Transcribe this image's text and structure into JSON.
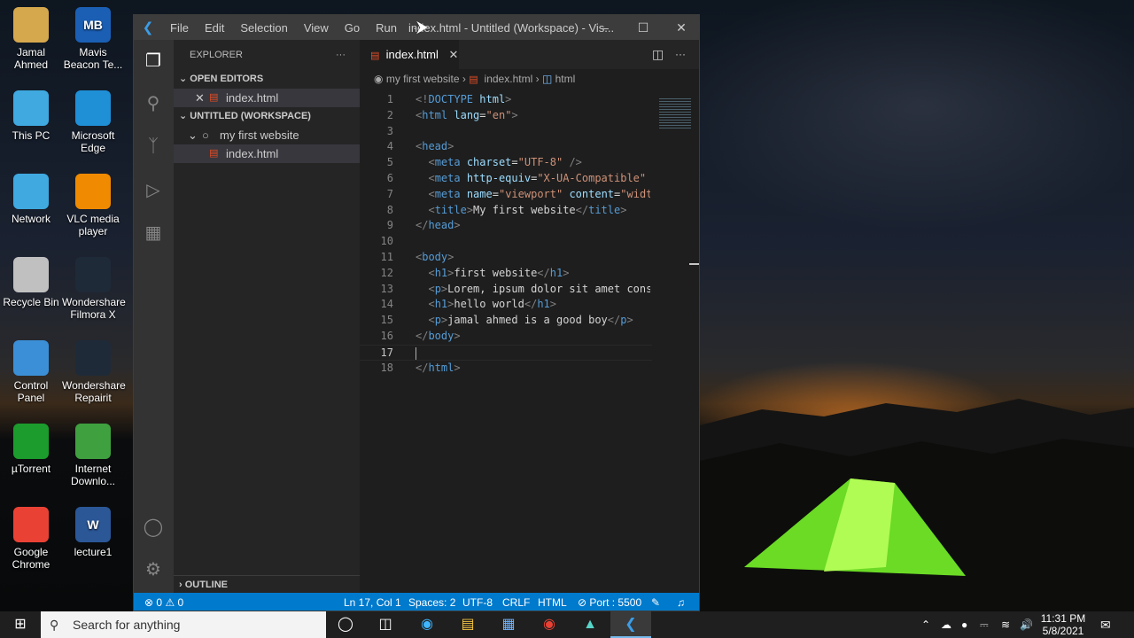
{
  "desktop": {
    "icons": [
      {
        "label": "Jamal Ahmed",
        "icon": "user-folder-icon"
      },
      {
        "label": "Mavis Beacon Te...",
        "icon": "mavis-beacon-icon",
        "glyph": "MB"
      },
      {
        "label": "This PC",
        "icon": "computer-icon"
      },
      {
        "label": "Microsoft Edge",
        "icon": "edge-icon"
      },
      {
        "label": "Network",
        "icon": "network-icon"
      },
      {
        "label": "VLC media player",
        "icon": "vlc-icon"
      },
      {
        "label": "Recycle Bin",
        "icon": "recycle-bin-icon"
      },
      {
        "label": "Wondershare Filmora X",
        "icon": "filmora-icon"
      },
      {
        "label": "Control Panel",
        "icon": "control-panel-icon"
      },
      {
        "label": "Wondershare Repairit",
        "icon": "repairit-icon"
      },
      {
        "label": "µTorrent",
        "icon": "utorrent-icon"
      },
      {
        "label": "Internet Downlo...",
        "icon": "idm-icon"
      },
      {
        "label": "Google Chrome",
        "icon": "chrome-icon"
      },
      {
        "label": "lecture1",
        "icon": "word-document-icon",
        "glyph": "W"
      }
    ]
  },
  "window": {
    "title": "index.html - Untitled (Workspace) - Vis...",
    "menu": [
      "File",
      "Edit",
      "Selection",
      "View",
      "Go",
      "Run",
      "···"
    ],
    "controls": {
      "minimize": "–",
      "maximize": "☐",
      "close": "✕"
    }
  },
  "sidebar": {
    "title": "EXPLORER",
    "more": "···",
    "open_editors_label": "OPEN EDITORS",
    "open_editors": [
      {
        "name": "index.html"
      }
    ],
    "workspace_label": "UNTITLED (WORKSPACE)",
    "folder": "my first website",
    "files": [
      {
        "name": "index.html"
      }
    ],
    "outline_label": "OUTLINE"
  },
  "editor": {
    "tab": "index.html",
    "breadcrumb": [
      "my first website",
      "index.html",
      "html"
    ],
    "current_line": 17,
    "lines": [
      [
        [
          "p",
          "<!"
        ],
        [
          "t",
          "DOCTYPE"
        ],
        [
          "x",
          " "
        ],
        [
          "a",
          "html"
        ],
        [
          "p",
          ">"
        ]
      ],
      [
        [
          "p",
          "<"
        ],
        [
          "t",
          "html"
        ],
        [
          "x",
          " "
        ],
        [
          "a",
          "lang"
        ],
        [
          "x",
          "="
        ],
        [
          "s",
          "\"en\""
        ],
        [
          "p",
          ">"
        ]
      ],
      [],
      [
        [
          "p",
          "<"
        ],
        [
          "t",
          "head"
        ],
        [
          "p",
          ">"
        ]
      ],
      [
        [
          "x",
          "  "
        ],
        [
          "p",
          "<"
        ],
        [
          "t",
          "meta"
        ],
        [
          "x",
          " "
        ],
        [
          "a",
          "charset"
        ],
        [
          "x",
          "="
        ],
        [
          "s",
          "\"UTF-8\""
        ],
        [
          "x",
          " "
        ],
        [
          "p",
          "/>"
        ]
      ],
      [
        [
          "x",
          "  "
        ],
        [
          "p",
          "<"
        ],
        [
          "t",
          "meta"
        ],
        [
          "x",
          " "
        ],
        [
          "a",
          "http-equiv"
        ],
        [
          "x",
          "="
        ],
        [
          "s",
          "\"X-UA-Compatible\""
        ]
      ],
      [
        [
          "x",
          "  "
        ],
        [
          "p",
          "<"
        ],
        [
          "t",
          "meta"
        ],
        [
          "x",
          " "
        ],
        [
          "a",
          "name"
        ],
        [
          "x",
          "="
        ],
        [
          "s",
          "\"viewport\""
        ],
        [
          "x",
          " "
        ],
        [
          "a",
          "content"
        ],
        [
          "x",
          "="
        ],
        [
          "s",
          "\"widt"
        ]
      ],
      [
        [
          "x",
          "  "
        ],
        [
          "p",
          "<"
        ],
        [
          "t",
          "title"
        ],
        [
          "p",
          ">"
        ],
        [
          "x",
          "My first website"
        ],
        [
          "p",
          "</"
        ],
        [
          "t",
          "title"
        ],
        [
          "p",
          ">"
        ]
      ],
      [
        [
          "p",
          "</"
        ],
        [
          "t",
          "head"
        ],
        [
          "p",
          ">"
        ]
      ],
      [],
      [
        [
          "p",
          "<"
        ],
        [
          "t",
          "body"
        ],
        [
          "p",
          ">"
        ]
      ],
      [
        [
          "x",
          "  "
        ],
        [
          "p",
          "<"
        ],
        [
          "t",
          "h1"
        ],
        [
          "p",
          ">"
        ],
        [
          "x",
          "first website"
        ],
        [
          "p",
          "</"
        ],
        [
          "t",
          "h1"
        ],
        [
          "p",
          ">"
        ]
      ],
      [
        [
          "x",
          "  "
        ],
        [
          "p",
          "<"
        ],
        [
          "t",
          "p"
        ],
        [
          "p",
          ">"
        ],
        [
          "x",
          "Lorem, ipsum dolor sit amet cons"
        ]
      ],
      [
        [
          "x",
          "  "
        ],
        [
          "p",
          "<"
        ],
        [
          "t",
          "h1"
        ],
        [
          "p",
          ">"
        ],
        [
          "x",
          "hello world"
        ],
        [
          "p",
          "</"
        ],
        [
          "t",
          "h1"
        ],
        [
          "p",
          ">"
        ]
      ],
      [
        [
          "x",
          "  "
        ],
        [
          "p",
          "<"
        ],
        [
          "t",
          "p"
        ],
        [
          "p",
          ">"
        ],
        [
          "x",
          "jamal ahmed is a good boy"
        ],
        [
          "p",
          "</"
        ],
        [
          "t",
          "p"
        ],
        [
          "p",
          ">"
        ]
      ],
      [
        [
          "p",
          "</"
        ],
        [
          "t",
          "body"
        ],
        [
          "p",
          ">"
        ]
      ],
      [],
      [
        [
          "p",
          "</"
        ],
        [
          "t",
          "html"
        ],
        [
          "p",
          ">"
        ]
      ]
    ]
  },
  "statusbar": {
    "errors": "0",
    "warnings": "0",
    "position": "Ln 17, Col 1",
    "spaces": "Spaces: 2",
    "encoding": "UTF-8",
    "eol": "CRLF",
    "language": "HTML",
    "port": "Port : 5500"
  },
  "taskbar": {
    "search_placeholder": "Search for anything",
    "time": "11:31 PM",
    "date": "5/8/2021"
  },
  "colors": {
    "accent": "#007acc",
    "titlebar": "#3c3c3c",
    "editor_bg": "#1e1e1e",
    "sidebar_bg": "#252526",
    "tag": "#569cd6",
    "attr": "#9cdcfe",
    "string": "#ce9178",
    "html_file": "#e44d26"
  }
}
